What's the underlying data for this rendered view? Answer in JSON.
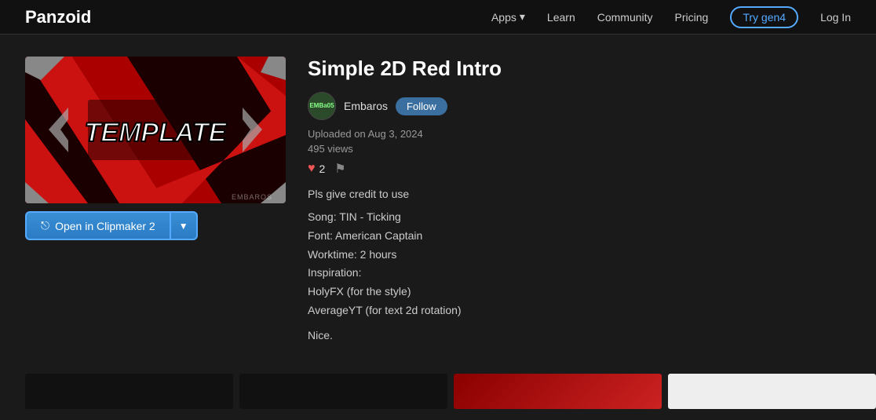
{
  "header": {
    "logo": "Panzoid",
    "nav": {
      "apps_label": "Apps",
      "apps_arrow": "▾",
      "learn_label": "Learn",
      "community_label": "Community",
      "pricing_label": "Pricing",
      "try_btn_label": "Try gen4",
      "login_label": "Log In"
    }
  },
  "content": {
    "title": "Simple 2D Red Intro",
    "author": {
      "name": "Embaros",
      "avatar_text": "EMBa05"
    },
    "follow_label": "Follow",
    "upload_date": "Uploaded on Aug 3, 2024",
    "views": "495 views",
    "likes_count": "2",
    "open_btn_label": "Open in Clipmaker 2",
    "open_icon": "⎋",
    "description": "Pls give credit to use",
    "details_line1": "Song: TIN - Ticking",
    "details_line2": "Font: American Captain",
    "details_line3": "Worktime: 2 hours",
    "details_line4": "Inspiration:",
    "details_line5": "HolyFX (for the style)",
    "details_line6": "AverageYT (for text 2d rotation)",
    "nice": "Nice."
  }
}
